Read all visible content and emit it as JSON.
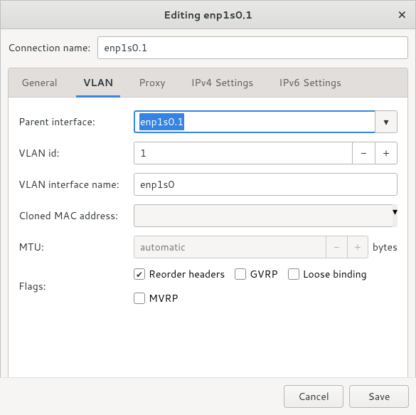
{
  "window": {
    "title": "Editing enp1s0.1"
  },
  "name_row": {
    "label": "Connection name:",
    "value": "enp1s0.1"
  },
  "tabs": {
    "general": "General",
    "vlan": "VLAN",
    "proxy": "Proxy",
    "ipv4": "IPv4 Settings",
    "ipv6": "IPv6 Settings"
  },
  "fields": {
    "parent": {
      "label": "Parent interface:",
      "value": "enp1s0.1"
    },
    "vlanid": {
      "label": "VLAN id:",
      "value": "1"
    },
    "ifname": {
      "label": "VLAN interface name:",
      "value": "enp1s0"
    },
    "mac": {
      "label": "Cloned MAC address:",
      "value": ""
    },
    "mtu": {
      "label": "MTU:",
      "placeholder": "automatic",
      "unit": "bytes"
    },
    "flags": {
      "label": "Flags:",
      "reorder": {
        "label": "Reorder headers",
        "checked": true
      },
      "gvrp": {
        "label": "GVRP",
        "checked": false
      },
      "loose": {
        "label": "Loose binding",
        "checked": false
      },
      "mvrp": {
        "label": "MVRP",
        "checked": false
      }
    }
  },
  "footer": {
    "cancel": "Cancel",
    "save": "Save"
  }
}
